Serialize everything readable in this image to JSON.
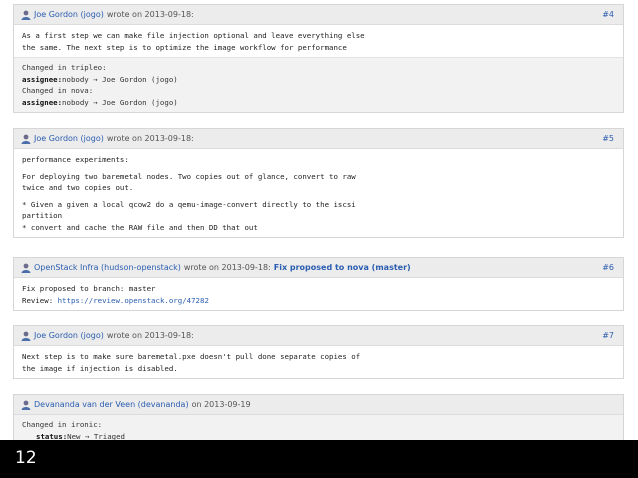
{
  "comments": [
    {
      "author": "Joe Gordon (jogo)",
      "action": "wrote on 2013-09-18:",
      "number": "#4",
      "body": [
        "As a first step we can make file injection optional and leave everything else",
        "the same. The next step is to optimize the image workflow for performance"
      ],
      "changes": [
        {
          "text": "Changed in tripleo:"
        },
        {
          "label": "assignee:",
          "text": "nobody → Joe Gordon (jogo)"
        },
        {
          "text": "Changed in nova:"
        },
        {
          "label": "assignee:",
          "text": "nobody → Joe Gordon (jogo)"
        }
      ]
    },
    {
      "author": "Joe Gordon (jogo)",
      "action": "wrote on 2013-09-18:",
      "number": "#5",
      "paragraphs": [
        [
          "performance experiments:"
        ],
        [
          "For deploying two baremetal nodes. Two copies out of glance, convert to raw",
          "twice and two copies out."
        ],
        [
          "* Given a given a local qcow2 do a qemu-image-convert directly to the iscsi",
          "partition",
          "* convert and cache the RAW file and then DD that out"
        ]
      ]
    },
    {
      "author": "OpenStack Infra (hudson-openstack)",
      "action": "wrote on 2013-09-18:",
      "title": "Fix proposed to nova (master)",
      "number": "#6",
      "line1": "Fix proposed to branch: master",
      "review_label": "Review: ",
      "review_url": "https://review.openstack.org/47282"
    },
    {
      "author": "Joe Gordon (jogo)",
      "action": "wrote on 2013-09-18:",
      "number": "#7",
      "body": [
        "Next step is to make sure baremetal.pxe doesn't pull done separate copies of",
        "the image if injection is disabled."
      ]
    },
    {
      "author": "Devananda van der Veen (devananda)",
      "action": "on 2013-09-19",
      "changes": [
        {
          "text": "Changed in ironic:"
        },
        {
          "label": "status:",
          "text": "New → Triaged"
        }
      ]
    }
  ],
  "slide_number": "12"
}
